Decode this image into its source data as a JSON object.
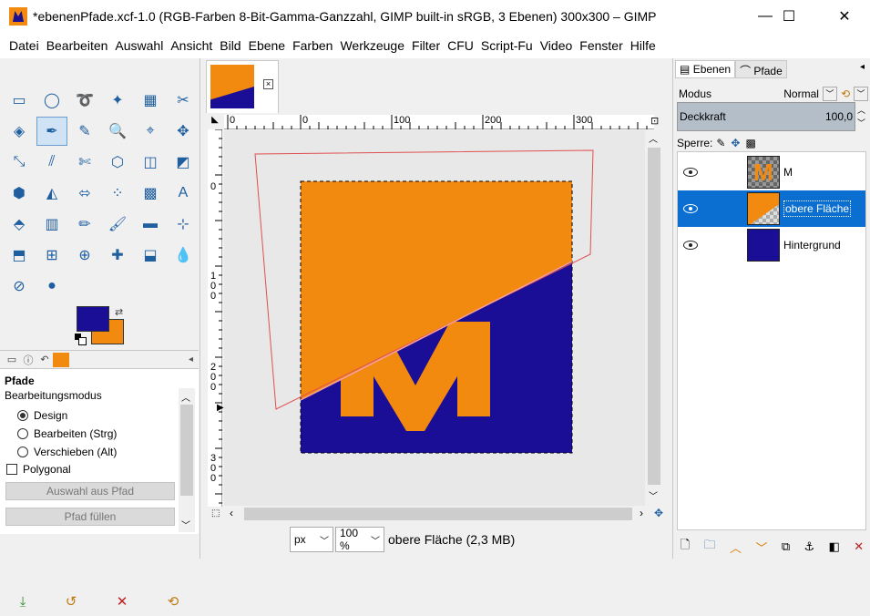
{
  "window": {
    "title": "*ebenenPfade.xcf-1.0 (RGB-Farben 8-Bit-Gamma-Ganzzahl, GIMP built-in sRGB, 3 Ebenen) 300x300 – GIMP",
    "minimize": "—",
    "maximize": "☐",
    "close": "✕"
  },
  "menu": [
    "Datei",
    "Bearbeiten",
    "Auswahl",
    "Ansicht",
    "Bild",
    "Ebene",
    "Farben",
    "Werkzeuge",
    "Filter",
    "CFU",
    "Script-Fu",
    "Video",
    "Fenster",
    "Hilfe"
  ],
  "toolbox": {
    "tools": [
      "▭",
      "◯",
      "➰",
      "✦",
      "▦",
      "✂",
      "◈",
      "✒",
      "✎",
      "🔍",
      "⌖",
      "✥",
      "⤡",
      "⫽",
      "✄",
      "⬡",
      "◫",
      "◩",
      "⬢",
      "◭",
      "⬄",
      "⁘",
      "▩",
      "A",
      "⬘",
      "▥",
      "✏",
      "🖌",
      "▬",
      "⊹",
      "⬒",
      "⊞",
      "⊕",
      "✚",
      "⬓",
      "💧",
      "⊘",
      "●"
    ],
    "active_tool_index": 7,
    "colors": {
      "foreground": "#1a0d96",
      "background": "#f28a0f"
    }
  },
  "tool_options": {
    "title": "Pfade",
    "mode_label": "Bearbeitungsmodus",
    "modes": [
      "Design",
      "Bearbeiten (Strg)",
      "Verschieben (Alt)"
    ],
    "selected_mode": 0,
    "polygonal_label": "Polygonal",
    "button_selection": "Auswahl aus Pfad",
    "button_fill": "Pfad füllen"
  },
  "image": {
    "ruler_h": [
      "0",
      "0",
      "100",
      "200",
      "300"
    ],
    "ruler_v": [
      "0",
      "1\n0\n0",
      "2\n0\n0",
      "3\n0\n0"
    ],
    "unit": "px",
    "zoom": "100 %",
    "status": "obere Fläche (2,3 MB)",
    "colors": {
      "orange": "#f28a0f",
      "blue": "#1a0d96",
      "path": "#e05050"
    }
  },
  "layers_dock": {
    "tab_layers": "Ebenen",
    "tab_paths": "Pfade",
    "mode_label": "Modus",
    "mode_value": "Normal",
    "opacity_label": "Deckkraft",
    "opacity_value": "100,0",
    "lock_label": "Sperre:",
    "layers": [
      {
        "name": "M",
        "selected": false
      },
      {
        "name": "obere Fläche",
        "selected": true
      },
      {
        "name": "Hintergrund",
        "selected": false
      }
    ]
  }
}
